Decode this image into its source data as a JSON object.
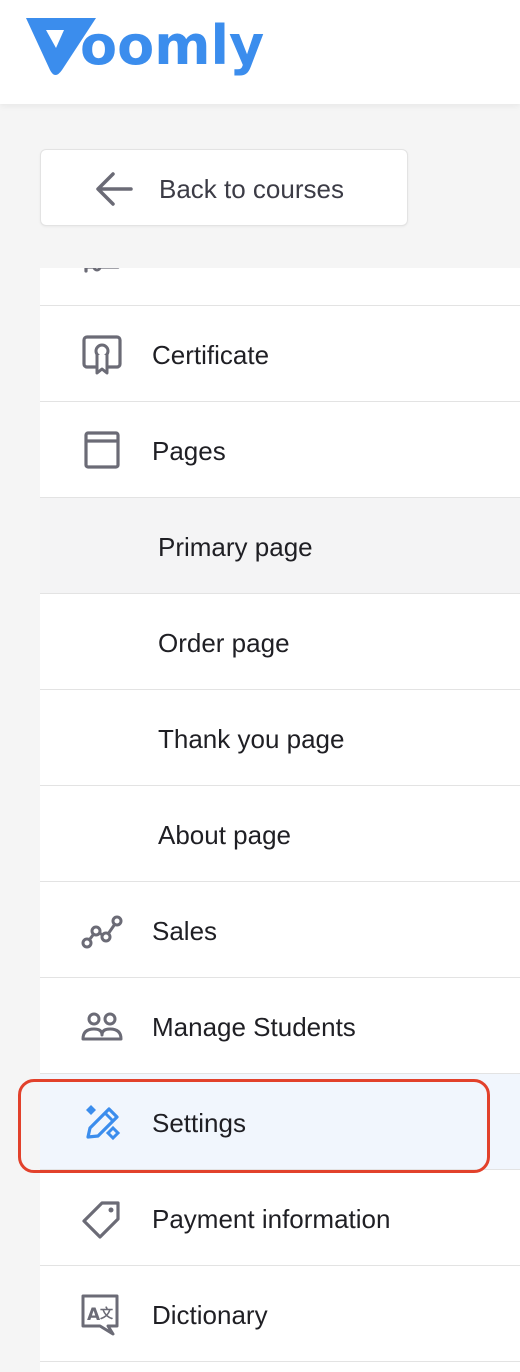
{
  "brand": {
    "name": "Voomly",
    "logo_text": "oomly",
    "color": "#3b8ded"
  },
  "back_button": {
    "label": "Back to courses",
    "icon": "arrow-left-icon"
  },
  "menu": {
    "items": [
      {
        "label": "",
        "icon": "curriculum-icon",
        "type": "item"
      },
      {
        "label": "Certificate",
        "icon": "certificate-icon",
        "type": "item"
      },
      {
        "label": "Pages",
        "icon": "pages-icon",
        "type": "item"
      },
      {
        "label": "Primary page",
        "icon": "",
        "type": "sub",
        "active": true
      },
      {
        "label": "Order page",
        "icon": "",
        "type": "sub"
      },
      {
        "label": "Thank you page",
        "icon": "",
        "type": "sub"
      },
      {
        "label": "About page",
        "icon": "",
        "type": "sub"
      },
      {
        "label": "Sales",
        "icon": "sales-chart-icon",
        "type": "item"
      },
      {
        "label": "Manage Students",
        "icon": "students-icon",
        "type": "item"
      },
      {
        "label": "Settings",
        "icon": "settings-pencil-icon",
        "type": "item",
        "selected": true
      },
      {
        "label": "Payment information",
        "icon": "price-tag-icon",
        "type": "item"
      },
      {
        "label": "Dictionary",
        "icon": "dictionary-icon",
        "type": "item"
      }
    ]
  },
  "colors": {
    "accent": "#3b8ded",
    "highlight_ring": "#e2412b",
    "selected_bg": "#f1f6fd",
    "icon_gray": "#6b6b76"
  }
}
